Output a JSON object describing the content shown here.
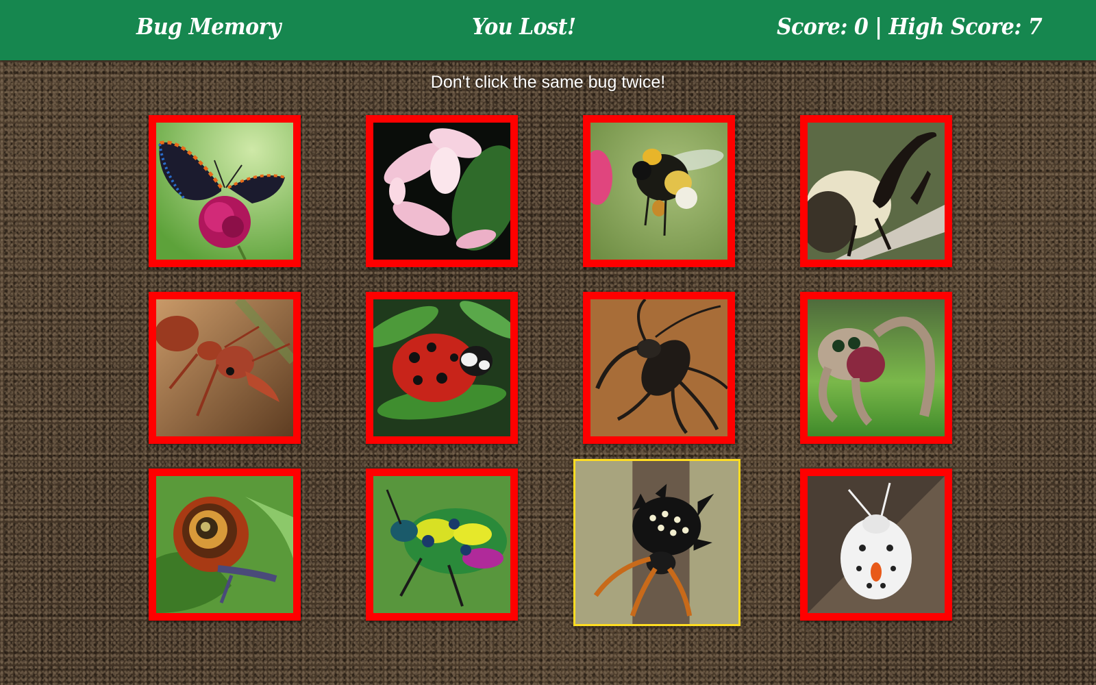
{
  "header": {
    "title": "Bug Memory",
    "status": "You Lost!",
    "score": "Score: 0 | High Score: 7",
    "background_color": "#16874f"
  },
  "instructions": "Don't click the same bug twice!",
  "colors": {
    "card_border": "#ff0000",
    "hover_border": "#ffdd22"
  },
  "cards": [
    {
      "icon": "butterfly-image"
    },
    {
      "icon": "orchid-mantis-image"
    },
    {
      "icon": "bumblebee-image"
    },
    {
      "icon": "rhinoceros-beetle-image"
    },
    {
      "icon": "fire-ant-image"
    },
    {
      "icon": "ladybug-image"
    },
    {
      "icon": "whip-scorpion-image"
    },
    {
      "icon": "jumping-spider-image"
    },
    {
      "icon": "snail-image"
    },
    {
      "icon": "jewel-beetle-image"
    },
    {
      "icon": "spiny-orb-weaver-image"
    },
    {
      "icon": "white-stink-bug-image"
    }
  ]
}
